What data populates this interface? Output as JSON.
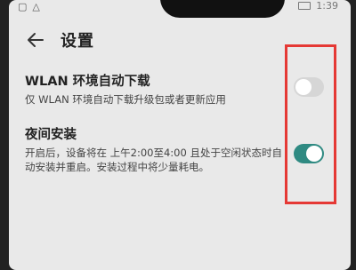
{
  "status": {
    "time": "1:39"
  },
  "header": {
    "title": "设置"
  },
  "settings": [
    {
      "label": "WLAN 环境自动下载",
      "description": "仅 WLAN 环境自动下载升级包或者更新应用",
      "enabled": false
    },
    {
      "label": "夜间安装",
      "description": "开启后，设备将在 上午2:00至4:00 且处于空闲状态时自动安装并重启。安装过程中将少量耗电。",
      "enabled": true
    }
  ],
  "colors": {
    "toggle_on": "#2f8a82",
    "toggle_off": "#d6d6d6",
    "highlight": "#e53935"
  }
}
